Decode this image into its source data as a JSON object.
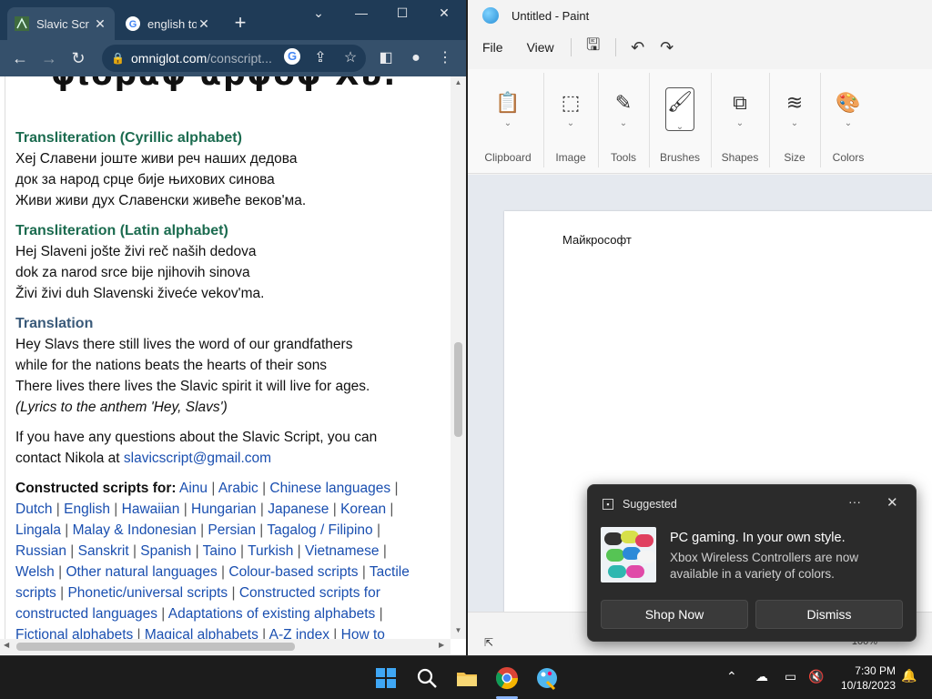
{
  "chrome": {
    "tabs": [
      {
        "label": "Slavic Scr",
        "active": true
      },
      {
        "label": "english to",
        "active": false
      }
    ],
    "new_tab": "+",
    "address": {
      "host": "omniglot.com",
      "path": "/conscript..."
    }
  },
  "page": {
    "cut_heading": "ψιοραφ αρψοφ Χυ.",
    "cyrillic_title": "Transliteration (Cyrillic alphabet)",
    "cyrillic_lines": [
      "Хеј Славени јоште живи реч наших дедова",
      "док за народ срце бије њихових синова",
      "Живи живи дух Славенски живеће веков'ма."
    ],
    "latin_title": "Transliteration (Latin alphabet)",
    "latin_lines": [
      "Hej Slaveni jošte živi reč naših dedova",
      "dok za narod srce bije njihovih sinova",
      "Živi živi duh Slavenski živeće vekov'ma."
    ],
    "translation_title": "Translation",
    "translation_lines": [
      "Hey Slavs there still lives the word of our grandfathers",
      "while for the nations beats the hearts of their sons",
      "There lives there lives the Slavic spirit it will live for ages."
    ],
    "translation_note": "(Lyrics to the anthem 'Hey, Slavs')",
    "contact_text_1": "If you have any questions about the Slavic Script, you can",
    "contact_text_2": "contact Nikola at ",
    "contact_email": "slavicscript@gmail.com",
    "constructed_label": "Constructed scripts for:",
    "constructed_links_l1": [
      "Ainu",
      "Arabic",
      "Chinese languages"
    ],
    "constructed_links_l2": [
      "Dutch",
      "English",
      "Hawaiian",
      "Hungarian",
      "Japanese",
      "Korean"
    ],
    "constructed_links_l3": [
      "Lingala",
      "Malay & Indonesian",
      "Persian",
      "Tagalog / Filipino"
    ],
    "constructed_links_l4": [
      "Russian",
      "Sanskrit",
      "Spanish",
      "Taino",
      "Turkish",
      "Vietnamese"
    ],
    "constructed_links_l5": [
      "Welsh",
      "Other natural languages",
      "Colour-based scripts",
      "Tactile"
    ],
    "constructed_links_l6": [
      "scripts",
      "Phonetic/universal scripts",
      "Constructed scripts for"
    ],
    "constructed_links_l7": [
      "constructed languages",
      "Adaptations of existing alphabets"
    ],
    "constructed_links_l8": [
      "Fictional alphabets",
      "Magical alphabets",
      "A-Z index",
      "How to"
    ]
  },
  "paint": {
    "title": "Untitled - Paint",
    "menu": [
      "File",
      "View"
    ],
    "groups": [
      "Clipboard",
      "Image",
      "Tools",
      "Brushes",
      "Shapes",
      "Size",
      "Colors"
    ],
    "canvas_text": "Майкрософт",
    "zoom": "100%"
  },
  "toast": {
    "header": "Suggested",
    "title": "PC gaming. In your own style.",
    "body": "Xbox Wireless Controllers are now available in a variety of colors.",
    "primary": "Shop Now",
    "secondary": "Dismiss"
  },
  "taskbar": {
    "time": "7:30 PM",
    "date": "10/18/2023"
  },
  "colors": {
    "chrome_frame": "#1f3b57",
    "chrome_toolbar": "#35506b",
    "link": "#1a4fb0",
    "heading_green": "#1b6b4f"
  }
}
